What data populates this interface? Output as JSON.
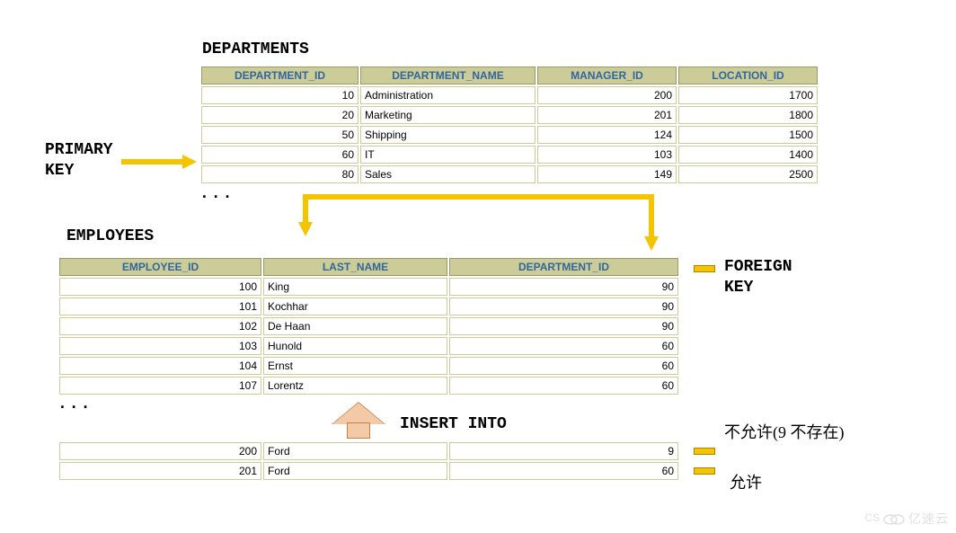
{
  "labels": {
    "departments_title": "DEPARTMENTS",
    "employees_title": "EMPLOYEES",
    "primary_line1": "PRIMARY",
    "primary_line2": "KEY",
    "foreign_line1": "FOREIGN",
    "foreign_line2": "KEY",
    "insert_into": "INSERT INTO",
    "disallow": "不允许(9 不存在)",
    "allow": "允许",
    "ellipsis": "..."
  },
  "dept_headers": [
    "DEPARTMENT_ID",
    "DEPARTMENT_NAME",
    "MANAGER_ID",
    "LOCATION_ID"
  ],
  "dept_rows": [
    {
      "id": "10",
      "name": "Administration",
      "mgr": "200",
      "loc": "1700"
    },
    {
      "id": "20",
      "name": "Marketing",
      "mgr": "201",
      "loc": "1800"
    },
    {
      "id": "50",
      "name": "Shipping",
      "mgr": "124",
      "loc": "1500"
    },
    {
      "id": "60",
      "name": "IT",
      "mgr": "103",
      "loc": "1400"
    },
    {
      "id": "80",
      "name": "Sales",
      "mgr": "149",
      "loc": "2500"
    }
  ],
  "emp_headers": [
    "EMPLOYEE_ID",
    "LAST_NAME",
    "DEPARTMENT_ID"
  ],
  "emp_rows": [
    {
      "id": "100",
      "name": "King",
      "dept": "90"
    },
    {
      "id": "101",
      "name": "Kochhar",
      "dept": "90"
    },
    {
      "id": "102",
      "name": "De Haan",
      "dept": "90"
    },
    {
      "id": "103",
      "name": "Hunold",
      "dept": "60"
    },
    {
      "id": "104",
      "name": "Ernst",
      "dept": "60"
    },
    {
      "id": "107",
      "name": "Lorentz",
      "dept": "60"
    }
  ],
  "insert_rows": [
    {
      "id": "200",
      "name": "Ford",
      "dept": "9"
    },
    {
      "id": "201",
      "name": "Ford",
      "dept": "60"
    }
  ],
  "watermark": "亿速云"
}
